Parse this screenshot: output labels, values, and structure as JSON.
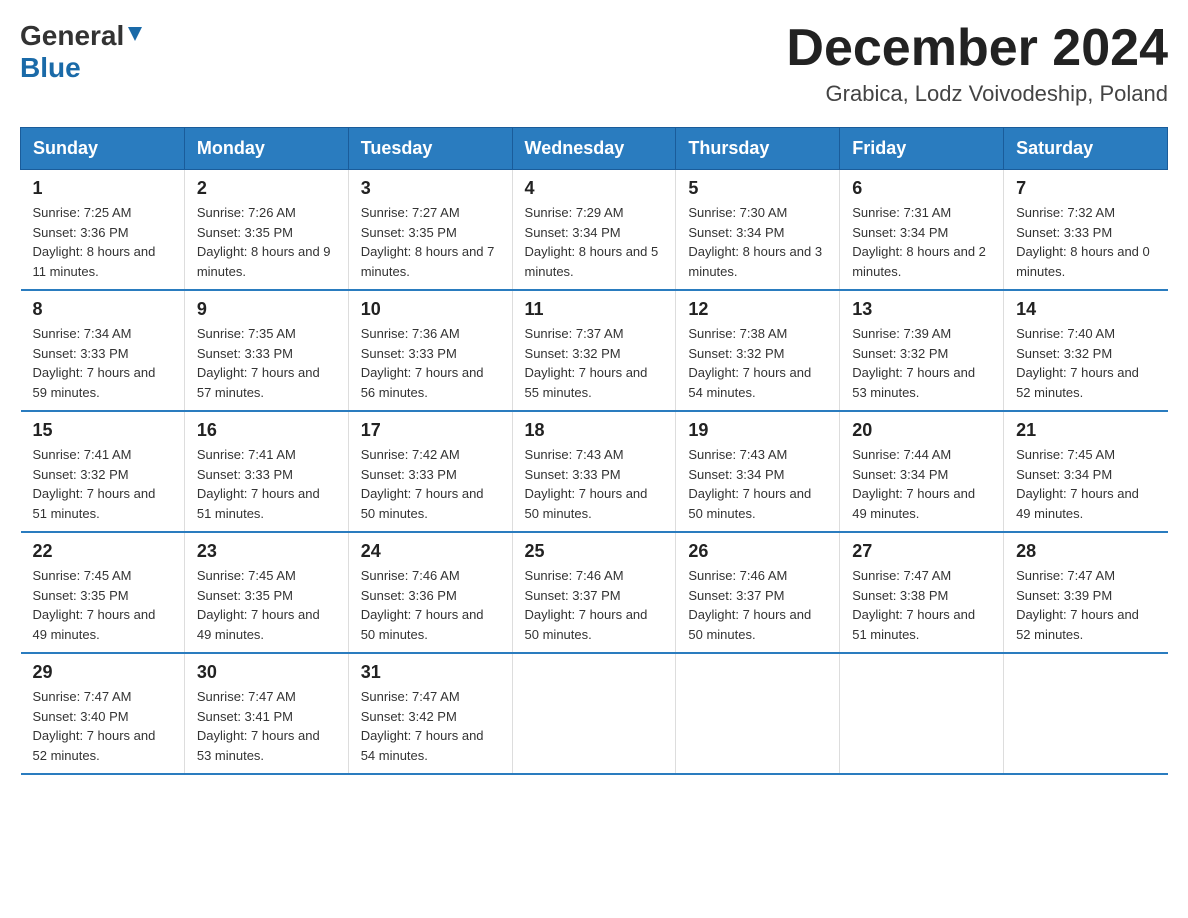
{
  "header": {
    "logo_general": "General",
    "logo_blue": "Blue",
    "month_title": "December 2024",
    "location": "Grabica, Lodz Voivodeship, Poland"
  },
  "weekdays": [
    "Sunday",
    "Monday",
    "Tuesday",
    "Wednesday",
    "Thursday",
    "Friday",
    "Saturday"
  ],
  "weeks": [
    [
      {
        "day": "1",
        "sunrise": "7:25 AM",
        "sunset": "3:36 PM",
        "daylight": "8 hours and 11 minutes."
      },
      {
        "day": "2",
        "sunrise": "7:26 AM",
        "sunset": "3:35 PM",
        "daylight": "8 hours and 9 minutes."
      },
      {
        "day": "3",
        "sunrise": "7:27 AM",
        "sunset": "3:35 PM",
        "daylight": "8 hours and 7 minutes."
      },
      {
        "day": "4",
        "sunrise": "7:29 AM",
        "sunset": "3:34 PM",
        "daylight": "8 hours and 5 minutes."
      },
      {
        "day": "5",
        "sunrise": "7:30 AM",
        "sunset": "3:34 PM",
        "daylight": "8 hours and 3 minutes."
      },
      {
        "day": "6",
        "sunrise": "7:31 AM",
        "sunset": "3:34 PM",
        "daylight": "8 hours and 2 minutes."
      },
      {
        "day": "7",
        "sunrise": "7:32 AM",
        "sunset": "3:33 PM",
        "daylight": "8 hours and 0 minutes."
      }
    ],
    [
      {
        "day": "8",
        "sunrise": "7:34 AM",
        "sunset": "3:33 PM",
        "daylight": "7 hours and 59 minutes."
      },
      {
        "day": "9",
        "sunrise": "7:35 AM",
        "sunset": "3:33 PM",
        "daylight": "7 hours and 57 minutes."
      },
      {
        "day": "10",
        "sunrise": "7:36 AM",
        "sunset": "3:33 PM",
        "daylight": "7 hours and 56 minutes."
      },
      {
        "day": "11",
        "sunrise": "7:37 AM",
        "sunset": "3:32 PM",
        "daylight": "7 hours and 55 minutes."
      },
      {
        "day": "12",
        "sunrise": "7:38 AM",
        "sunset": "3:32 PM",
        "daylight": "7 hours and 54 minutes."
      },
      {
        "day": "13",
        "sunrise": "7:39 AM",
        "sunset": "3:32 PM",
        "daylight": "7 hours and 53 minutes."
      },
      {
        "day": "14",
        "sunrise": "7:40 AM",
        "sunset": "3:32 PM",
        "daylight": "7 hours and 52 minutes."
      }
    ],
    [
      {
        "day": "15",
        "sunrise": "7:41 AM",
        "sunset": "3:32 PM",
        "daylight": "7 hours and 51 minutes."
      },
      {
        "day": "16",
        "sunrise": "7:41 AM",
        "sunset": "3:33 PM",
        "daylight": "7 hours and 51 minutes."
      },
      {
        "day": "17",
        "sunrise": "7:42 AM",
        "sunset": "3:33 PM",
        "daylight": "7 hours and 50 minutes."
      },
      {
        "day": "18",
        "sunrise": "7:43 AM",
        "sunset": "3:33 PM",
        "daylight": "7 hours and 50 minutes."
      },
      {
        "day": "19",
        "sunrise": "7:43 AM",
        "sunset": "3:34 PM",
        "daylight": "7 hours and 50 minutes."
      },
      {
        "day": "20",
        "sunrise": "7:44 AM",
        "sunset": "3:34 PM",
        "daylight": "7 hours and 49 minutes."
      },
      {
        "day": "21",
        "sunrise": "7:45 AM",
        "sunset": "3:34 PM",
        "daylight": "7 hours and 49 minutes."
      }
    ],
    [
      {
        "day": "22",
        "sunrise": "7:45 AM",
        "sunset": "3:35 PM",
        "daylight": "7 hours and 49 minutes."
      },
      {
        "day": "23",
        "sunrise": "7:45 AM",
        "sunset": "3:35 PM",
        "daylight": "7 hours and 49 minutes."
      },
      {
        "day": "24",
        "sunrise": "7:46 AM",
        "sunset": "3:36 PM",
        "daylight": "7 hours and 50 minutes."
      },
      {
        "day": "25",
        "sunrise": "7:46 AM",
        "sunset": "3:37 PM",
        "daylight": "7 hours and 50 minutes."
      },
      {
        "day": "26",
        "sunrise": "7:46 AM",
        "sunset": "3:37 PM",
        "daylight": "7 hours and 50 minutes."
      },
      {
        "day": "27",
        "sunrise": "7:47 AM",
        "sunset": "3:38 PM",
        "daylight": "7 hours and 51 minutes."
      },
      {
        "day": "28",
        "sunrise": "7:47 AM",
        "sunset": "3:39 PM",
        "daylight": "7 hours and 52 minutes."
      }
    ],
    [
      {
        "day": "29",
        "sunrise": "7:47 AM",
        "sunset": "3:40 PM",
        "daylight": "7 hours and 52 minutes."
      },
      {
        "day": "30",
        "sunrise": "7:47 AM",
        "sunset": "3:41 PM",
        "daylight": "7 hours and 53 minutes."
      },
      {
        "day": "31",
        "sunrise": "7:47 AM",
        "sunset": "3:42 PM",
        "daylight": "7 hours and 54 minutes."
      },
      null,
      null,
      null,
      null
    ]
  ],
  "labels": {
    "sunrise_prefix": "Sunrise: ",
    "sunset_prefix": "Sunset: ",
    "daylight_prefix": "Daylight: "
  }
}
